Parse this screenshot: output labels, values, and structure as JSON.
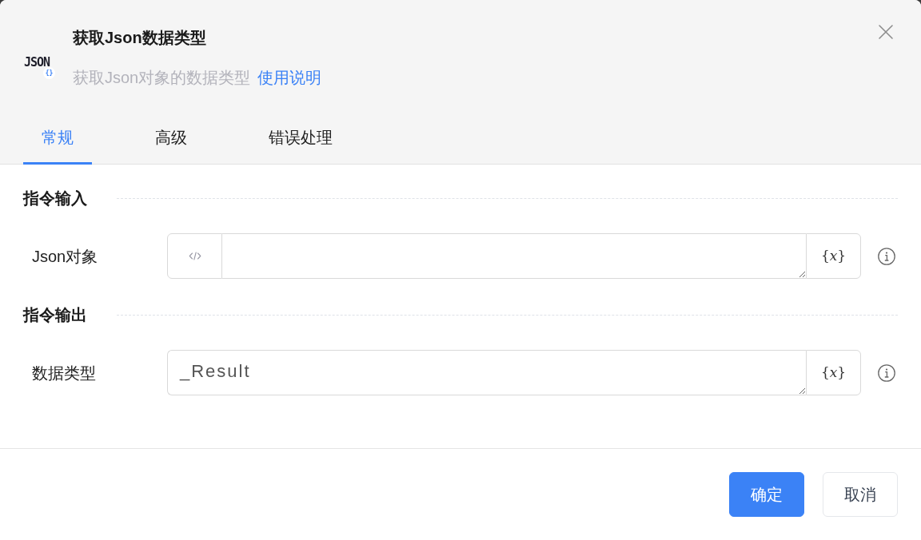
{
  "dialog": {
    "logo": {
      "text": "JSON",
      "badge": "{}"
    },
    "title": "获取Json数据类型",
    "description": "获取Json对象的数据类型",
    "help_link": "使用说明"
  },
  "tabs": [
    {
      "label": "常规",
      "selected": true
    },
    {
      "label": "高级",
      "selected": false
    },
    {
      "label": "错误处理",
      "selected": false
    }
  ],
  "sections": [
    {
      "title": "指令输入",
      "fields": [
        {
          "label": "Json对象",
          "kind": "code",
          "variable_button": "{*x*}"
        }
      ]
    },
    {
      "title": "指令输出",
      "fields": [
        {
          "label": "数据类型",
          "kind": "text",
          "value": "_Result",
          "variable_button": "{*x*}"
        }
      ]
    }
  ],
  "buttons": [
    {
      "label": "确定",
      "kind": "primary"
    },
    {
      "label": "取消",
      "kind": "secondary"
    }
  ]
}
